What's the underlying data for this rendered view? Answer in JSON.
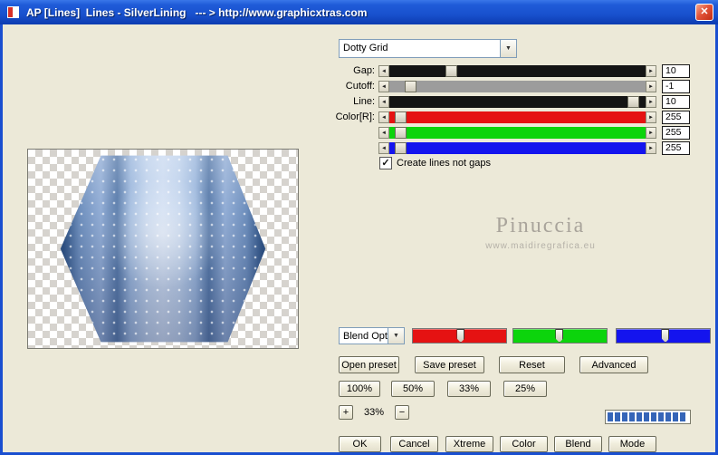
{
  "window": {
    "title": "AP [Lines]  Lines - SilverLining   --- > http://www.graphicxtras.com"
  },
  "glyphs": {
    "left_arrow": "◄",
    "right_arrow": "►",
    "dropdown_arrow": "▼",
    "check": "✓",
    "close": "✕"
  },
  "colors": {
    "titlebar_blue": "#1850cd",
    "window_border": "#1a4fd0",
    "background_beige": "#ece9d8",
    "slider_black_track": "#141414",
    "slider_gray_track": "#9c9c9c",
    "red": "#e51212",
    "green": "#0cd40c",
    "blue": "#1414ee",
    "progress_segment": "#3565b8"
  },
  "preset_dropdown": {
    "value": "Dotty Grid"
  },
  "sliders": [
    {
      "label": "Gap:",
      "value": "10",
      "track_color": "#141414",
      "thumb_left": "22%"
    },
    {
      "label": "Cutoff:",
      "value": "-1",
      "track_color": "#9c9c9c",
      "thumb_left": "6%"
    },
    {
      "label": "Line:",
      "value": "10",
      "track_color": "#141414",
      "thumb_left": "93%"
    },
    {
      "label": "Color[R]:",
      "value": "255",
      "track_color": "#e51212",
      "thumb_left": "2%"
    },
    {
      "label": "",
      "value": "255",
      "track_color": "#0cd40c",
      "thumb_left": "2%"
    },
    {
      "label": "",
      "value": "255",
      "track_color": "#1414ee",
      "thumb_left": "2%"
    }
  ],
  "checkbox": {
    "label": "Create lines not gaps",
    "checked": true
  },
  "watermark": {
    "name": "Pinuccia",
    "url": "www.maidiregrafica.eu"
  },
  "blend_dropdown": {
    "value": "Blend Opti"
  },
  "trackbars": [
    {
      "name": "red-trackbar",
      "color": "#e51212",
      "thumb_left": "47%"
    },
    {
      "name": "green-trackbar",
      "color": "#0cd40c",
      "thumb_left": "45%"
    },
    {
      "name": "blue-trackbar",
      "color": "#1414ee",
      "thumb_left": "48%"
    }
  ],
  "preset_buttons": [
    "Open preset",
    "Save preset",
    "Reset",
    "Advanced"
  ],
  "zoom_buttons": [
    "100%",
    "50%",
    "33%",
    "25%"
  ],
  "zoom_control": {
    "plus": "+",
    "value": "33%",
    "minus": "−"
  },
  "progress": {
    "segments": 11
  },
  "bottom_buttons": [
    "OK",
    "Cancel",
    "Xtreme",
    "Color",
    "Blend",
    "Mode"
  ]
}
